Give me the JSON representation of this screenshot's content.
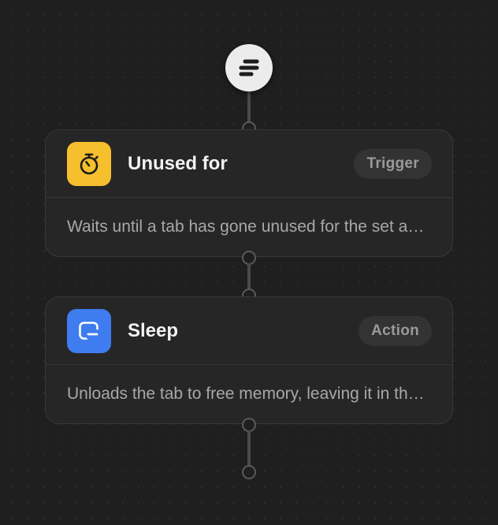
{
  "workflow": {
    "start_node": {
      "icon": "flow-start-icon"
    },
    "steps": [
      {
        "title": "Unused for",
        "badge": "Trigger",
        "description": "Waits until a tab has gone unused for the set amount of time",
        "icon": "stopwatch-icon",
        "icon_bg": "#f6bf2d"
      },
      {
        "title": "Sleep",
        "badge": "Action",
        "description": "Unloads the tab to free memory, leaving it in the tab strip",
        "icon": "tab-sleep-icon",
        "icon_bg": "#3f7cf0"
      }
    ]
  },
  "colors": {
    "background": "#1f1f1f",
    "card": "#262626",
    "card_border": "#383838",
    "badge_bg": "#333333",
    "connector": "#4a4a4a"
  }
}
